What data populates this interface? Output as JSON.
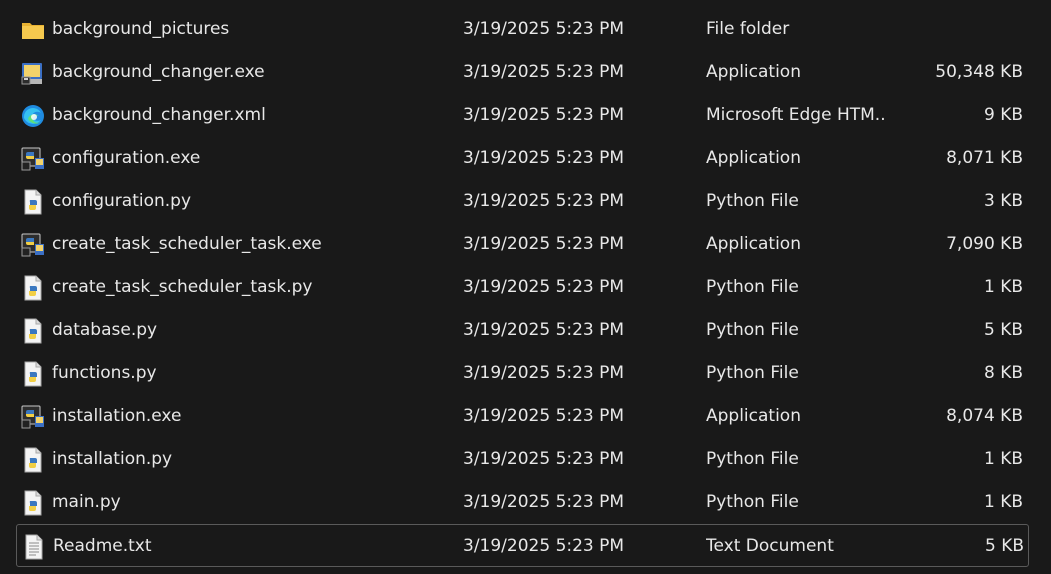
{
  "files": [
    {
      "name": "background_pictures",
      "date": "3/19/2025 5:23 PM",
      "type": "File folder",
      "size": "",
      "icon": "folder-icon"
    },
    {
      "name": "background_changer.exe",
      "date": "3/19/2025 5:23 PM",
      "type": "Application",
      "size": "50,348 KB",
      "icon": "app-exe-icon"
    },
    {
      "name": "background_changer.xml",
      "date": "3/19/2025 5:23 PM",
      "type": "Microsoft Edge HTM...",
      "size": "9 KB",
      "icon": "edge-icon"
    },
    {
      "name": "configuration.exe",
      "date": "3/19/2025 5:23 PM",
      "type": "Application",
      "size": "8,071 KB",
      "icon": "python-exe-icon"
    },
    {
      "name": "configuration.py",
      "date": "3/19/2025 5:23 PM",
      "type": "Python File",
      "size": "3 KB",
      "icon": "python-file-icon"
    },
    {
      "name": "create_task_scheduler_task.exe",
      "date": "3/19/2025 5:23 PM",
      "type": "Application",
      "size": "7,090 KB",
      "icon": "python-exe-icon"
    },
    {
      "name": "create_task_scheduler_task.py",
      "date": "3/19/2025 5:23 PM",
      "type": "Python File",
      "size": "1 KB",
      "icon": "python-file-icon"
    },
    {
      "name": "database.py",
      "date": "3/19/2025 5:23 PM",
      "type": "Python File",
      "size": "5 KB",
      "icon": "python-file-icon"
    },
    {
      "name": "functions.py",
      "date": "3/19/2025 5:23 PM",
      "type": "Python File",
      "size": "8 KB",
      "icon": "python-file-icon"
    },
    {
      "name": "installation.exe",
      "date": "3/19/2025 5:23 PM",
      "type": "Application",
      "size": "8,074 KB",
      "icon": "python-exe-icon"
    },
    {
      "name": "installation.py",
      "date": "3/19/2025 5:23 PM",
      "type": "Python File",
      "size": "1 KB",
      "icon": "python-file-icon"
    },
    {
      "name": "main.py",
      "date": "3/19/2025 5:23 PM",
      "type": "Python File",
      "size": "1 KB",
      "icon": "python-file-icon"
    },
    {
      "name": "Readme.txt",
      "date": "3/19/2025 5:23 PM",
      "type": "Text Document",
      "size": "5 KB",
      "icon": "text-file-icon"
    }
  ],
  "focused_index": 12,
  "colors": {
    "background": "#191919",
    "text": "#e8e8e8",
    "focus_border": "#5a5a5a"
  }
}
